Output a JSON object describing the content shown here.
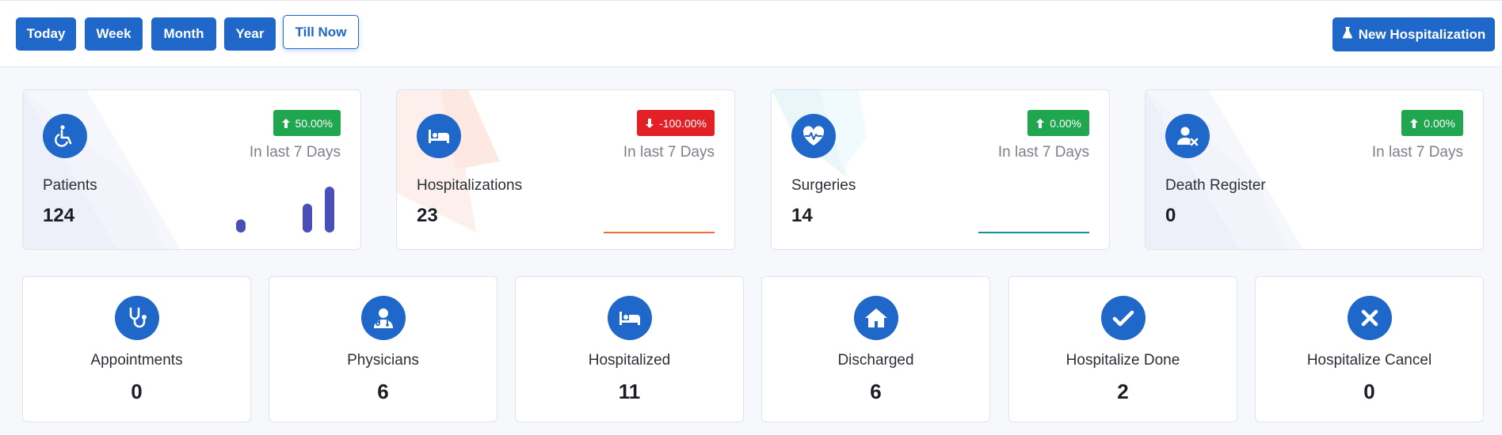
{
  "toolbar": {
    "ranges": [
      "Today",
      "Week",
      "Month",
      "Year",
      "Till Now"
    ],
    "active_range": "Till Now",
    "new_button_label": "New Hospitalization",
    "new_button_icon": "flask-icon"
  },
  "stats": [
    {
      "title": "Patients",
      "value": "124",
      "change": "50.00%",
      "trend": "up",
      "period": "In last 7 Days",
      "icon": "wheelchair-icon",
      "chart": {
        "type": "bar",
        "values": [
          1,
          0,
          0,
          2.2,
          3.5
        ]
      },
      "accent": "#4a4fb8"
    },
    {
      "title": "Hospitalizations",
      "value": "23",
      "change": "-100.00%",
      "trend": "down",
      "period": "In last 7 Days",
      "icon": "bed-icon",
      "chart": {
        "type": "line",
        "values": [
          0,
          0,
          0,
          0,
          0
        ]
      },
      "accent": "#f26b3a"
    },
    {
      "title": "Surgeries",
      "value": "14",
      "change": "0.00%",
      "trend": "up",
      "period": "In last 7 Days",
      "icon": "heartbeat-icon",
      "chart": {
        "type": "line",
        "values": [
          0,
          0,
          0,
          0,
          0
        ]
      },
      "accent": "#1a8f9c"
    },
    {
      "title": "Death Register",
      "value": "0",
      "change": "0.00%",
      "trend": "up",
      "period": "In last 7 Days",
      "icon": "user-x-icon",
      "chart": {
        "type": "none",
        "values": []
      },
      "accent": "#4a4fb8"
    }
  ],
  "summary": [
    {
      "title": "Appointments",
      "value": "0",
      "icon": "stethoscope-icon"
    },
    {
      "title": "Physicians",
      "value": "6",
      "icon": "doctor-icon"
    },
    {
      "title": "Hospitalized",
      "value": "11",
      "icon": "bed-icon"
    },
    {
      "title": "Discharged",
      "value": "6",
      "icon": "home-icon"
    },
    {
      "title": "Hospitalize Done",
      "value": "2",
      "icon": "check-icon"
    },
    {
      "title": "Hospitalize Cancel",
      "value": "0",
      "icon": "x-icon"
    }
  ],
  "colors": {
    "primary": "#1f67c9",
    "success": "#1fa64f",
    "danger": "#e32026"
  }
}
